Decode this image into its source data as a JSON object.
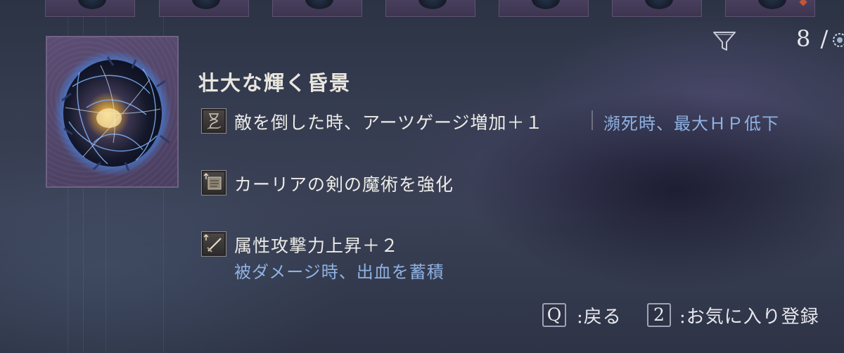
{
  "inventory": {
    "count_text": "8 /"
  },
  "item": {
    "name": "壮大な輝く昏景",
    "effects": [
      {
        "icon": "hourglass-icon",
        "text": "敵を倒した時、アーツゲージ増加＋１",
        "curse": "瀕死時、最大ＨＰ低下"
      },
      {
        "icon": "scroll-icon",
        "text": "カーリアの剣の魔術を強化",
        "curse": ""
      },
      {
        "icon": "sword-icon",
        "text": "属性攻撃力上昇＋２",
        "curse": "被ダメージ時、出血を蓄積"
      }
    ]
  },
  "footer": {
    "back_key": "Q",
    "back_label": ":戻る",
    "favorite_key": "2",
    "favorite_label": ":お気に入り登録"
  },
  "colors": {
    "curse_text": "#8fb2e2",
    "frame_border": "#6f6284",
    "slot_marker": "#c25636"
  }
}
